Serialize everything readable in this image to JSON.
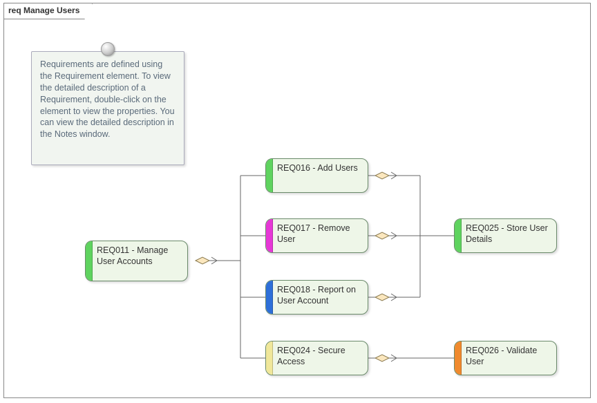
{
  "frame": {
    "title": "req Manage Users"
  },
  "note": {
    "text": "Requirements are defined using the Requirement element.  To view the detailed description of a Requirement, double-click on the element to view the properties. You can view the detailed description in the Notes window."
  },
  "requirements": {
    "req011": {
      "label": "REQ011 - Manage User Accounts",
      "color": "#5fd35f"
    },
    "req016": {
      "label": "REQ016 - Add Users",
      "color": "#5fd35f"
    },
    "req017": {
      "label": "REQ017 - Remove User",
      "color": "#e638d6"
    },
    "req018": {
      "label": "REQ018 - Report on User Account",
      "color": "#2e6fd8"
    },
    "req024": {
      "label": "REQ024 - Secure Access",
      "color": "#f0e79a"
    },
    "req025": {
      "label": "REQ025 - Store User Details",
      "color": "#5fd35f"
    },
    "req026": {
      "label": "REQ026 - Validate User",
      "color": "#f08a2e"
    }
  }
}
